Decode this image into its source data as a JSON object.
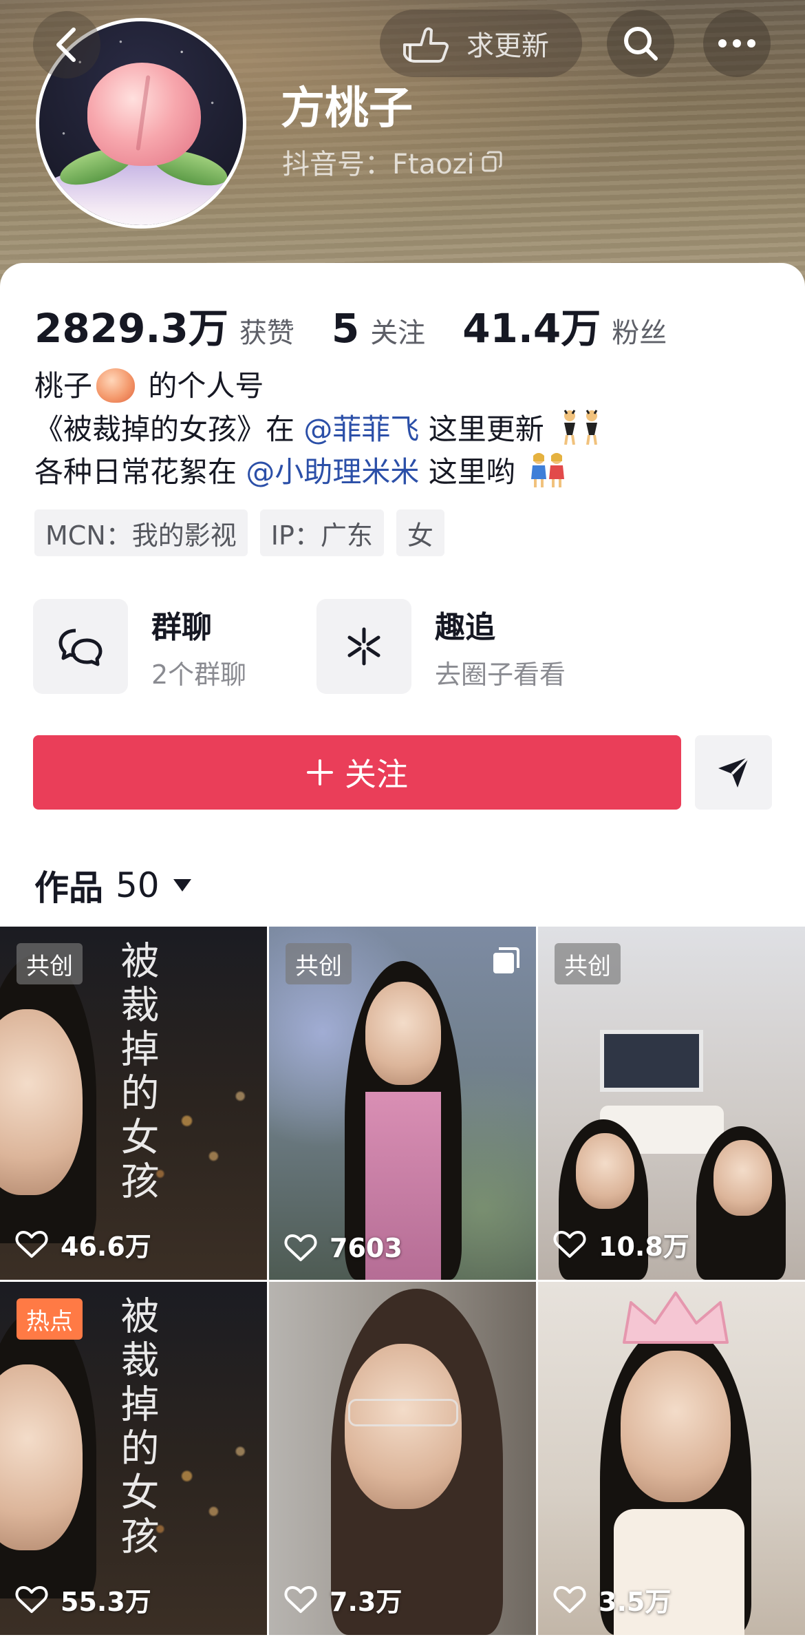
{
  "header": {
    "update_label": "求更新",
    "name": "方桃子",
    "douyin_id": "抖音号：Ftaozi"
  },
  "stats": {
    "likes_value": "2829.3万",
    "likes_label": "获赞",
    "following_value": "5",
    "following_label": "关注",
    "followers_value": "41.4万",
    "followers_label": "粉丝"
  },
  "bio": {
    "line1_prefix": "桃子",
    "line1_suffix": "的个人号",
    "line2_prefix": "《被裁掉的女孩》在",
    "line2_mention": "@菲菲飞",
    "line2_suffix": "这里更新",
    "line3_prefix": "各种日常花絮在",
    "line3_mention": "@小助理米米",
    "line3_suffix": "这里哟"
  },
  "tags": [
    "MCN：我的影视",
    "IP：广东",
    "女"
  ],
  "features": {
    "group_title": "群聊",
    "group_sub": "2个群聊",
    "follow_title": "趣追",
    "follow_sub": "去圈子看看"
  },
  "actions": {
    "follow_label": "关注"
  },
  "works": {
    "label": "作品",
    "count": "50"
  },
  "grid": [
    {
      "badge": "共创",
      "likes": "46.6万",
      "overlay": "被裁掉的女孩"
    },
    {
      "badge": "共创",
      "likes": "7603",
      "overlay": ""
    },
    {
      "badge": "共创",
      "likes": "10.8万",
      "overlay": ""
    },
    {
      "badge": "热点",
      "likes": "55.3万",
      "overlay": "被裁掉的女孩"
    },
    {
      "badge": "",
      "likes": "7.3万",
      "overlay": ""
    },
    {
      "badge": "",
      "likes": "3.5万",
      "overlay": ""
    }
  ],
  "colors": {
    "accent": "#ea3e59",
    "mention": "#2b4fa8",
    "hot_badge": "#ff7a45"
  },
  "icons": [
    "back-icon",
    "hand-point-icon",
    "search-icon",
    "more-icon",
    "copy-icon",
    "chat-icon",
    "spark-icon",
    "plus-icon",
    "send-icon",
    "triangle-down-icon",
    "heart-icon"
  ]
}
